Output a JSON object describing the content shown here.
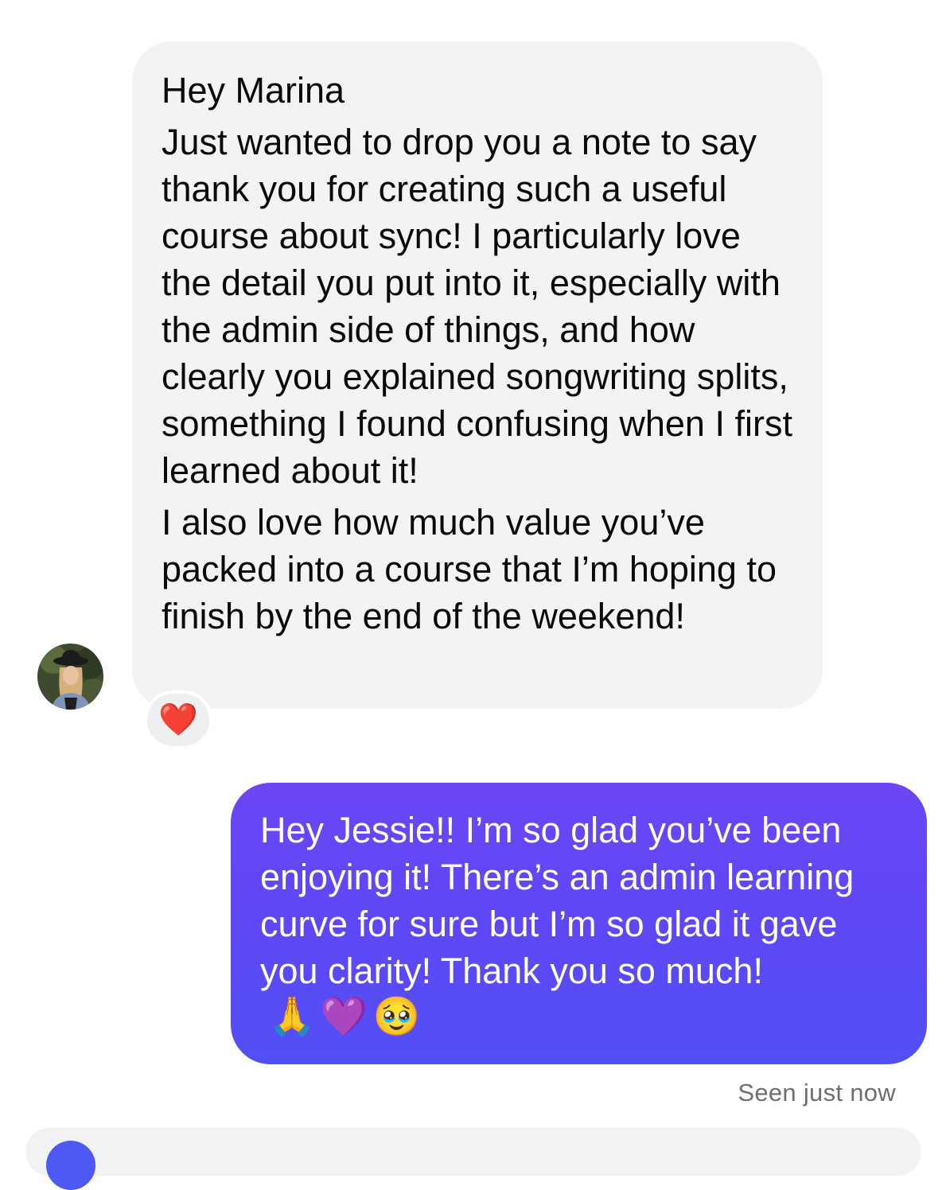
{
  "incoming_message": {
    "paragraphs": [
      "Hey Marina",
      "Just wanted to drop you a note to say thank you for creating such a useful course about sync! I particularly love the detail you put into it, especially with the admin side of things, and how clearly you explained songwriting splits, something I found confusing when I first learned about it!",
      "I also love how much value you’ve packed into a course that I’m hoping to finish by the end of the weekend!"
    ],
    "reaction": "❤️",
    "bubble_color": "#f2f3f5"
  },
  "outgoing_message": {
    "text": "Hey Jessie!! I’m so glad you’ve been enjoying it!  There’s an admin learning curve for sure but I’m so glad it gave you clarity! Thank you so much!",
    "emojis": [
      "🙏",
      "💜",
      "🥹"
    ],
    "gradient_colors": [
      "#6b46f5",
      "#5250f4"
    ]
  },
  "status": {
    "seen": "Seen just now"
  },
  "avatar": {
    "icon": "profile-photo"
  }
}
